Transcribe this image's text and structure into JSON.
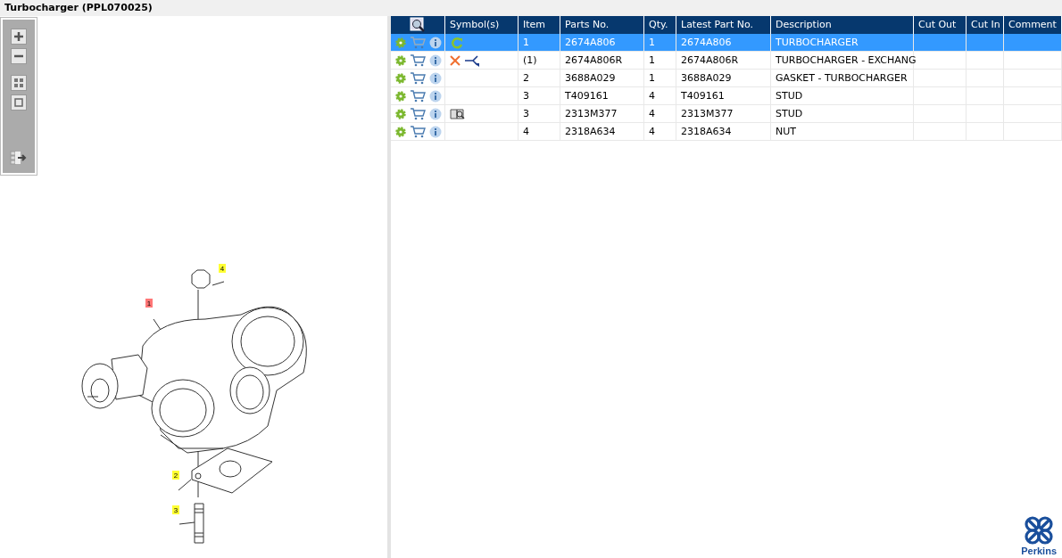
{
  "title": "Turbocharger (PPL070025)",
  "callouts": [
    {
      "label": "1",
      "selected": true
    },
    {
      "label": "2",
      "selected": false
    },
    {
      "label": "3",
      "selected": false
    },
    {
      "label": "4",
      "selected": false
    }
  ],
  "table": {
    "columns": [
      "Symbol(s)",
      "Item",
      "Parts No.",
      "Qty.",
      "Latest Part No.",
      "Description",
      "Cut Out",
      "Cut In",
      "Comment"
    ],
    "rows": [
      {
        "selected": true,
        "symbols": [
          {
            "kind": "rotate"
          }
        ],
        "item": "1",
        "part_no": "2674A806",
        "qty": "1",
        "latest_part_no": "2674A806",
        "description": "TURBOCHARGER"
      },
      {
        "selected": false,
        "symbols": [
          {
            "kind": "cross"
          },
          {
            "kind": "split"
          }
        ],
        "item": "(1)",
        "part_no": "2674A806R",
        "qty": "1",
        "latest_part_no": "2674A806R",
        "description": "TURBOCHARGER - EXCHANG"
      },
      {
        "selected": false,
        "symbols": [],
        "item": "2",
        "part_no": "3688A029",
        "qty": "1",
        "latest_part_no": "3688A029",
        "description": "GASKET - TURBOCHARGER"
      },
      {
        "selected": false,
        "symbols": [],
        "item": "3",
        "part_no": "T409161",
        "qty": "4",
        "latest_part_no": "T409161",
        "description": "STUD"
      },
      {
        "selected": false,
        "symbols": [
          {
            "kind": "book"
          }
        ],
        "item": "3",
        "part_no": "2313M377",
        "qty": "4",
        "latest_part_no": "2313M377",
        "description": "STUD"
      },
      {
        "selected": false,
        "symbols": [],
        "item": "4",
        "part_no": "2318A634",
        "qty": "4",
        "latest_part_no": "2318A634",
        "description": "NUT"
      }
    ]
  },
  "logo": {
    "text": "Perkins"
  }
}
